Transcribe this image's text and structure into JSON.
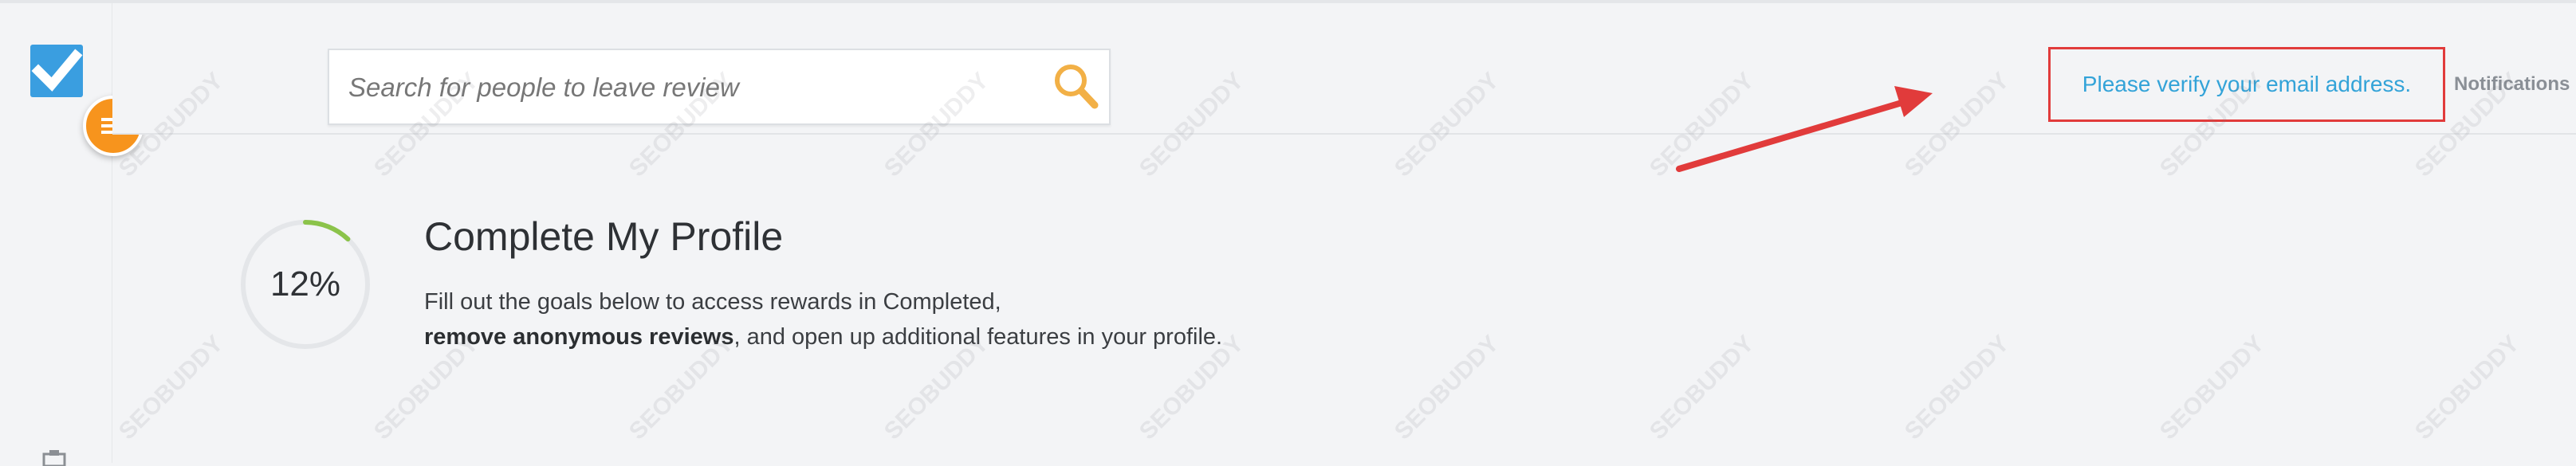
{
  "search": {
    "placeholder": "Search for people to leave review"
  },
  "header": {
    "verify_email": "Please verify your email address.",
    "notifications": "Notifications"
  },
  "profile": {
    "progress": 12,
    "progress_label": "12%",
    "title": "Complete My Profile",
    "desc_line1": "Fill out the goals below to access rewards in Completed,",
    "desc_bold": "remove anonymous reviews",
    "desc_rest": ", and open up additional features in your profile."
  },
  "watermark": {
    "text": "SEOBUDDY"
  },
  "colors": {
    "accent": "#33a3d8",
    "menu": "#f7941d",
    "logo": "#3a9ee0",
    "progress": "#8bc34a",
    "highlight": "#e13b3b"
  }
}
